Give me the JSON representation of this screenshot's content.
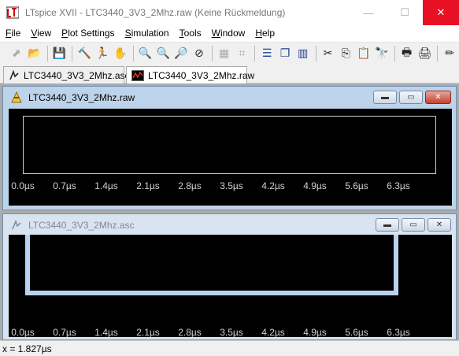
{
  "window": {
    "title": "LTspice XVII - LTC3440_3V3_2Mhz.raw (Keine Rückmeldung)",
    "controls": {
      "minimize": "—",
      "maximize": "☐",
      "close": "✕"
    }
  },
  "menu": [
    {
      "accel": "F",
      "rest": "ile"
    },
    {
      "accel": "V",
      "rest": "iew"
    },
    {
      "accel": "P",
      "rest": "lot Settings"
    },
    {
      "accel": "S",
      "rest": "imulation"
    },
    {
      "accel": "T",
      "rest": "ools"
    },
    {
      "accel": "W",
      "rest": "indow"
    },
    {
      "accel": "H",
      "rest": "elp"
    }
  ],
  "toolbar_icons": [
    "open-schematic-icon",
    "open-folder-icon",
    "save-icon",
    "hammer-control-panel-icon",
    "run-icon",
    "pan-hand-icon",
    "zoom-in-icon",
    "zoom-area-icon",
    "zoom-out-icon",
    "zoom-cancel-icon",
    "autorange-icon",
    "mark-unmark-icon",
    "tile-horizontal-icon",
    "cascade-icon",
    "tile-vertical-icon",
    "cut-icon",
    "copy-icon",
    "find-icon",
    "print-setup-icon",
    "print-icon",
    "pencil-icon"
  ],
  "tabs": [
    {
      "label": "LTC3440_3V3_2Mhz.asc",
      "icon": "schematic-icon"
    },
    {
      "label": "LTC3440_3V3_2Mhz.raw",
      "icon": "waveform-icon"
    }
  ],
  "waveform_window": {
    "title": "LTC3440_3V3_2Mhz.raw",
    "ticks": [
      "0.0µs",
      "0.7µs",
      "1.4µs",
      "2.1µs",
      "2.8µs",
      "3.5µs",
      "4.2µs",
      "4.9µs",
      "5.6µs",
      "6.3µs"
    ]
  },
  "schematic_window": {
    "title": "LTC3440_3V3_2Mhz.asc",
    "ticks": [
      "0.0µs",
      "0.7µs",
      "1.4µs",
      "2.1µs",
      "2.8µs",
      "3.5µs",
      "4.2µs",
      "4.9µs",
      "5.6µs",
      "6.3µs"
    ]
  },
  "status": {
    "text": "x = 1.827µs"
  },
  "colors": {
    "tick_text": "#d0d0d0",
    "plot_bg": "#000000",
    "plot_frame": "#cfcfcf",
    "ghost_frame": "#b9d3ef"
  }
}
